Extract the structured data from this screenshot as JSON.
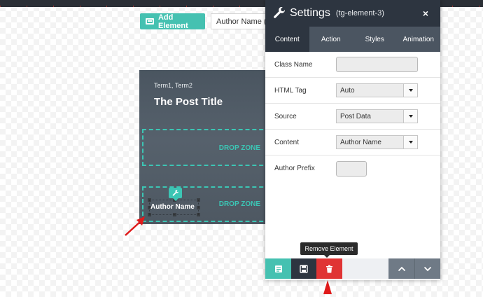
{
  "toolbar": {
    "add_element_label": "Add Element",
    "element_select_value": "Author Name (t"
  },
  "card": {
    "terms": "Term1, Term2",
    "title": "The Post Title",
    "drop_zone_1": "DROP ZONE",
    "drop_zone_2": "DROP ZONE",
    "author_element": "Author Name"
  },
  "settings": {
    "title": "Settings",
    "element_id": "(tg-element-3)",
    "close_symbol": "×",
    "tabs": [
      "Content",
      "Action",
      "Styles",
      "Animation"
    ],
    "active_tab": "Content",
    "fields": {
      "class_name": {
        "label": "Class Name",
        "value": ""
      },
      "html_tag": {
        "label": "HTML Tag",
        "value": "Auto"
      },
      "source": {
        "label": "Source",
        "value": "Post Data"
      },
      "content": {
        "label": "Content",
        "value": "Author Name"
      },
      "author_prefix": {
        "label": "Author Prefix",
        "value": ""
      }
    }
  },
  "tooltip": {
    "text": "Remove Element"
  },
  "footer": {
    "colors": {
      "teal": "#45c1b1",
      "navy": "#2d3540",
      "red": "#e03434",
      "gray": "#6f7a86",
      "light": "#eef0f3"
    },
    "icons": [
      "notes-icon",
      "save-icon",
      "trash-icon",
      "chevron-up-icon",
      "chevron-down-icon"
    ]
  },
  "colors": {
    "accent": "#45c1b1",
    "panel_header": "#2d3540",
    "annotation_arrow": "#e01b1b"
  }
}
